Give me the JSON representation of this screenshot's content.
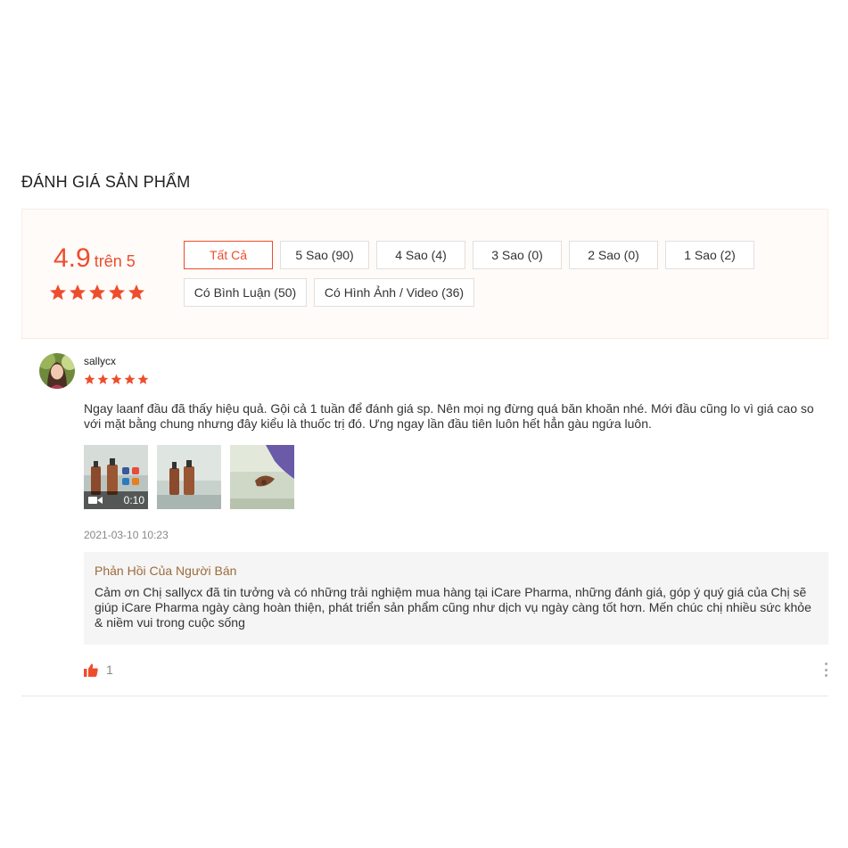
{
  "section_title": "ĐÁNH GIÁ SẢN PHẨM",
  "rating": {
    "score": "4.9",
    "out_of": "trên 5",
    "stars": 5
  },
  "filters": {
    "all": "Tất Cả",
    "five_star": "5 Sao (90)",
    "four_star": "4 Sao (4)",
    "three_star": "3 Sao (0)",
    "two_star": "2 Sao (0)",
    "one_star": "1 Sao (2)",
    "with_comment": "Có Bình Luận (50)",
    "with_media": "Có Hình Ảnh / Video (36)"
  },
  "review": {
    "username": "sallycx",
    "stars": 5,
    "comment": "Ngay laanf đầu đã thấy hiệu quả. Gội cả 1 tuần để đánh giá sp. Nên mọi ng đừng quá băn khoăn nhé. Mới đầu cũng lo vì giá cao so với mặt bằng chung  nhưng đây kiểu là thuốc trị đó. Ưng ngay lần đầu tiên luôn  hết hẳn gàu ngứa luôn.",
    "video_duration": "0:10",
    "timestamp": "2021-03-10 10:23",
    "seller_reply_title": "Phản Hồi Của Người Bán",
    "seller_reply_text": "Cảm ơn Chị  sallycx đã tin tưởng và có những trải nghiệm mua hàng tại iCare Pharma, những đánh giá, góp ý quý giá của Chị sẽ giúp iCare Pharma ngày càng hoàn thiện, phát triển sản phẩm cũng như dịch vụ ngày càng tốt hơn. Mến chúc chị nhiều sức khỏe & niềm vui trong cuộc sống",
    "likes": "1"
  },
  "colors": {
    "accent": "#ee4d2d",
    "seller_title": "#9c6b3b",
    "reply_bg": "#f5f5f5",
    "overview_bg": "#fffbf8"
  }
}
